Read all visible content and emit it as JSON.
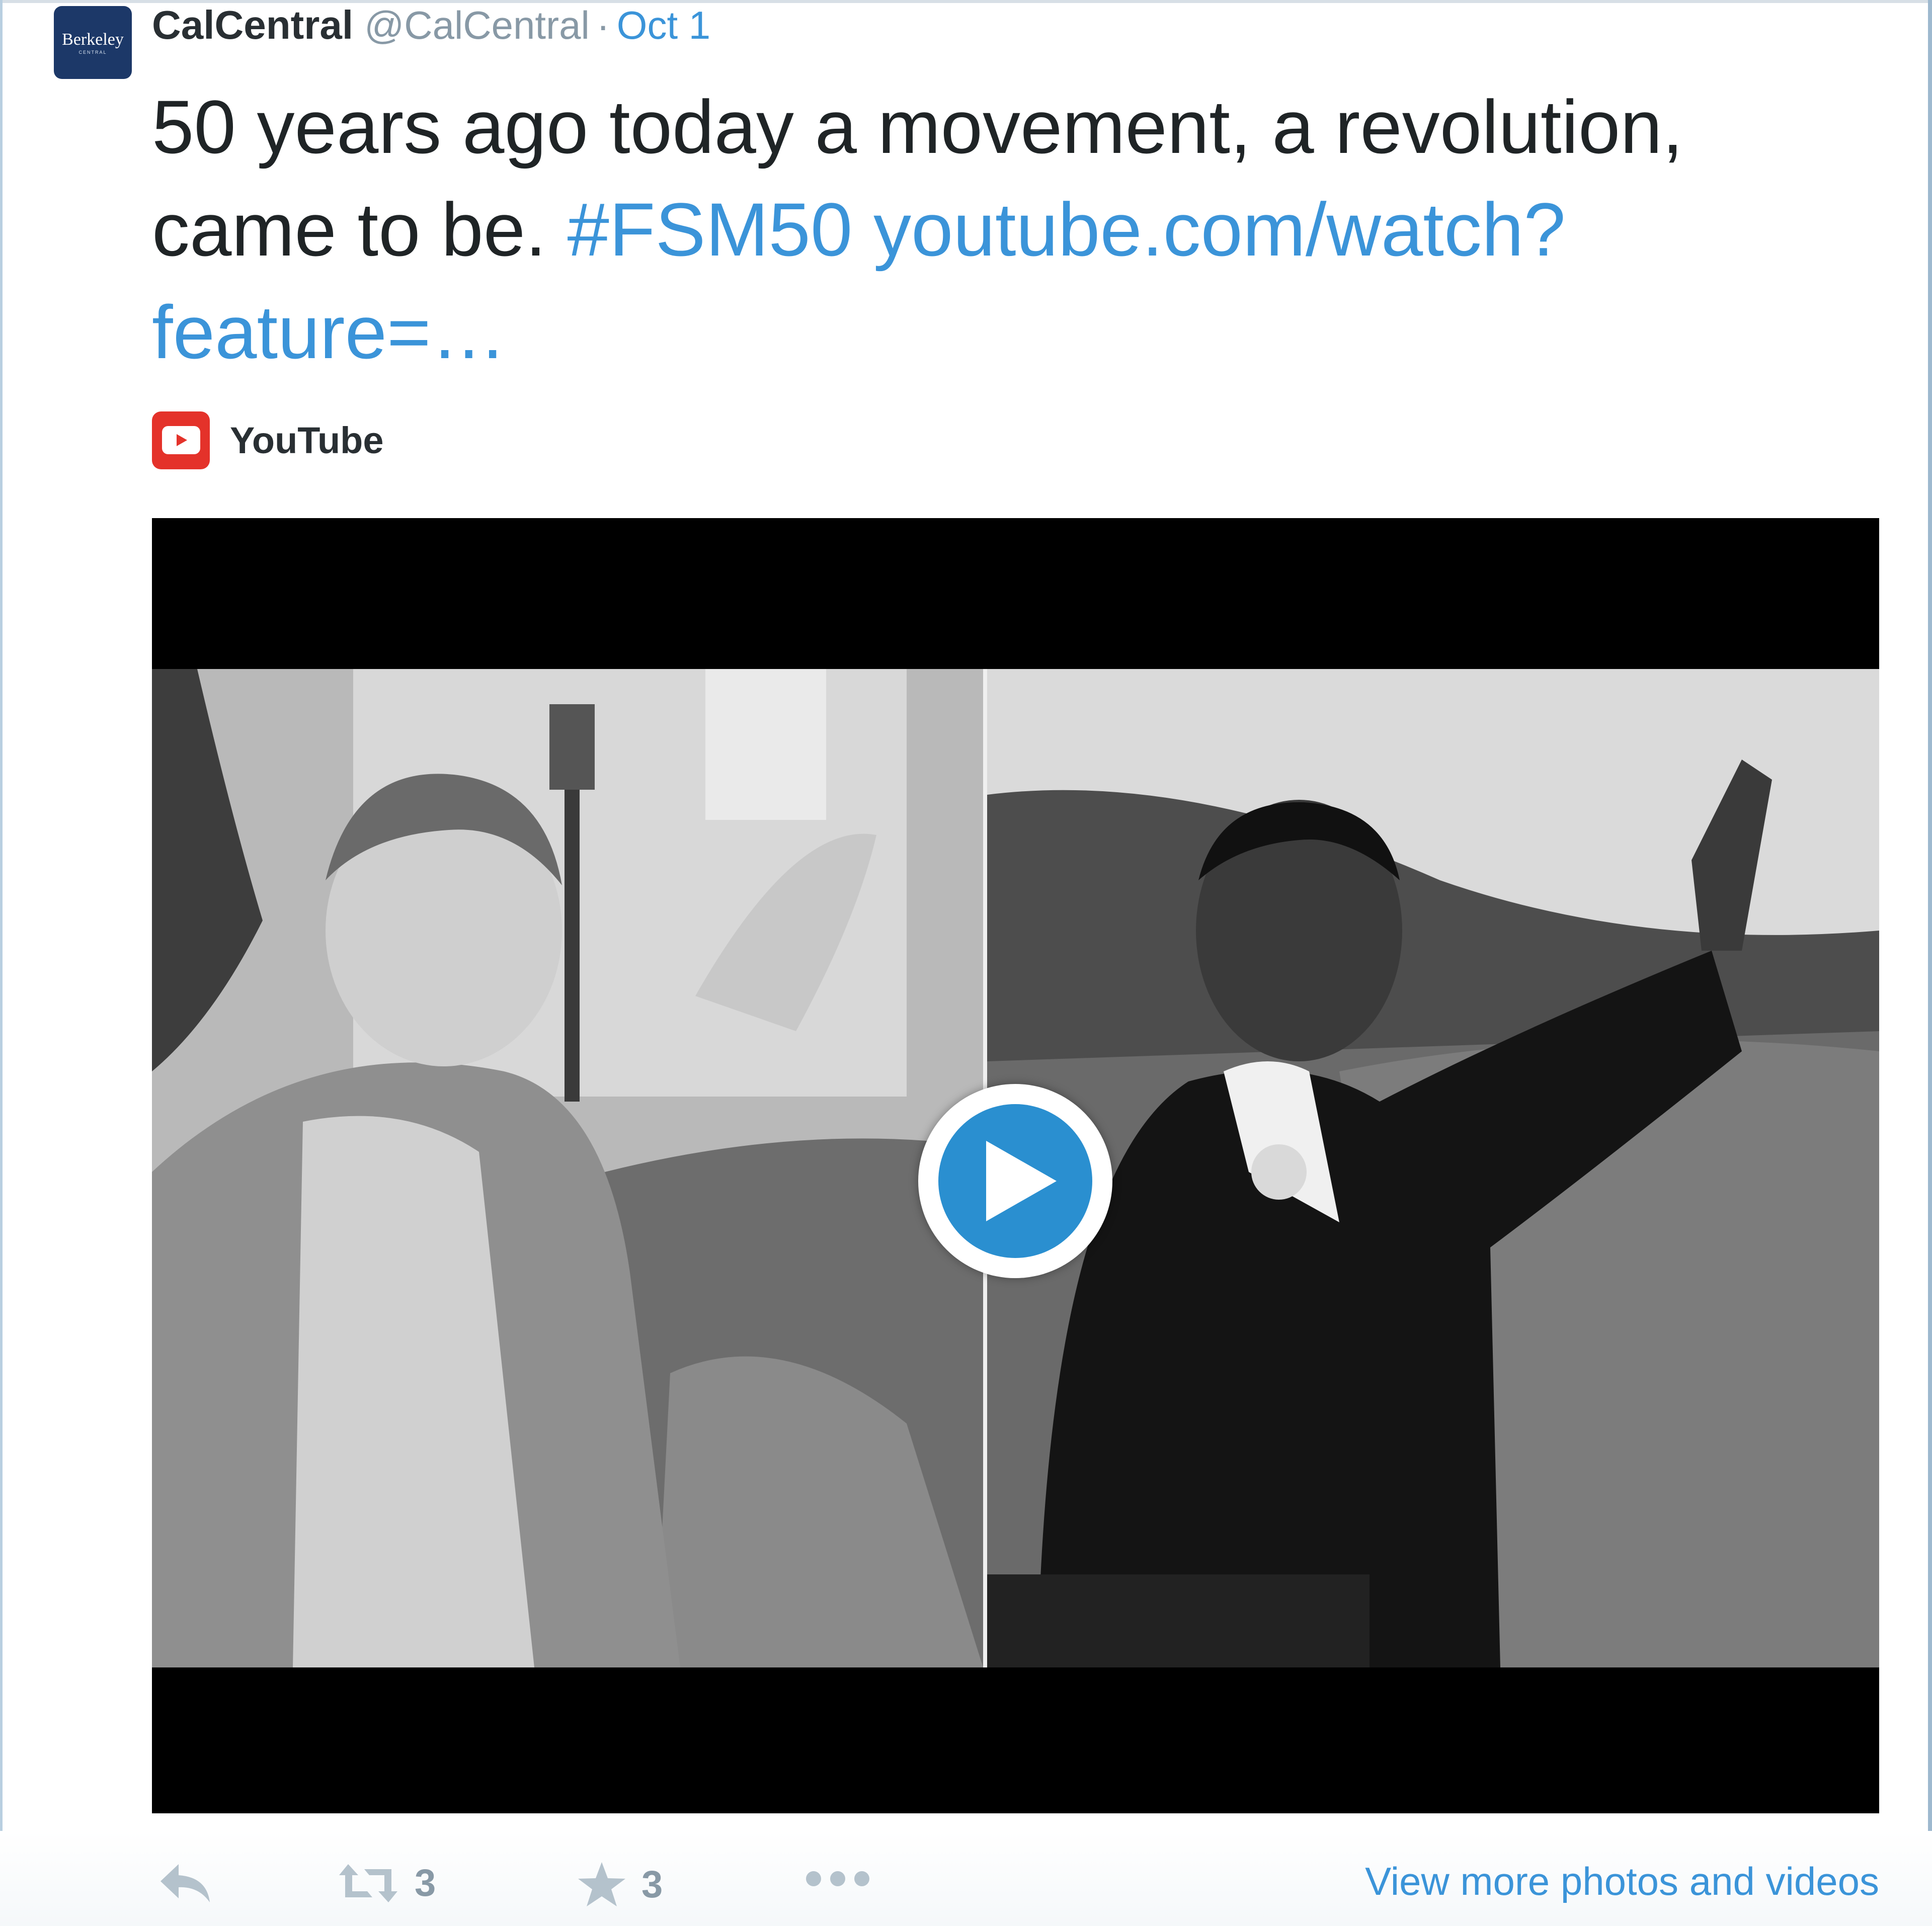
{
  "colors": {
    "link": "#3b94d9",
    "muted": "#8899a6",
    "text": "#292f33",
    "youtube_red": "#e4322a",
    "play_blue": "#2a8fd0",
    "avatar_navy": "#1c3868"
  },
  "avatar": {
    "brand_text": "Berkeley",
    "sub_text": "CENTRAL"
  },
  "tweet": {
    "fullname": "CalCentral",
    "handle": "@CalCentral",
    "separator": "·",
    "date": "Oct 1",
    "text_plain": "50 years ago today a movement, a revolution, came to be.",
    "hashtag": "#FSM50",
    "link_text": "youtube.com/watch?feature=…"
  },
  "card": {
    "source_icon": "youtube-icon",
    "source_label": "YouTube",
    "video_play_icon": "play-icon"
  },
  "actions": {
    "reply_icon": "reply-icon",
    "retweet_icon": "retweet-icon",
    "retweet_count": "3",
    "favorite_icon": "star-icon",
    "favorite_count": "3",
    "more_icon": "more-dots-icon",
    "view_more": "View more photos and videos"
  }
}
